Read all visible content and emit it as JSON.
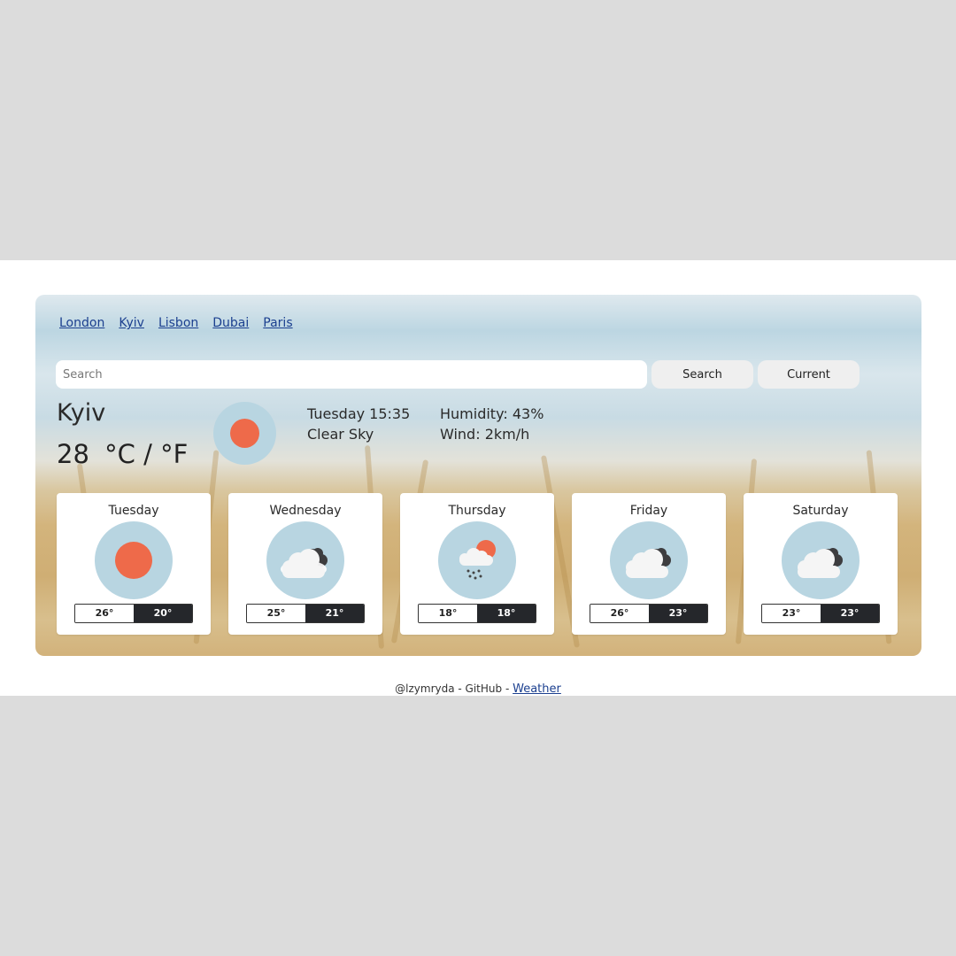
{
  "nav": {
    "cities": [
      "London",
      "Kyiv",
      "Lisbon",
      "Dubai",
      "Paris"
    ]
  },
  "search": {
    "placeholder": "Search",
    "search_label": "Search",
    "current_label": "Current"
  },
  "current": {
    "city": "Kyiv",
    "temperature": "28",
    "units": "°C / °F",
    "icon": "sun-icon",
    "datetime": "Tuesday 15:35",
    "description": "Clear Sky",
    "humidity": "Humidity: 43%",
    "wind": "Wind: 2km/h"
  },
  "forecast": [
    {
      "day": "Tuesday",
      "icon": "sun-icon",
      "max": "26°",
      "min": "20°"
    },
    {
      "day": "Wednesday",
      "icon": "cloud-icon",
      "max": "25°",
      "min": "21°"
    },
    {
      "day": "Thursday",
      "icon": "rain-sun-icon",
      "max": "18°",
      "min": "18°"
    },
    {
      "day": "Friday",
      "icon": "cloud-icon",
      "max": "26°",
      "min": "23°"
    },
    {
      "day": "Saturday",
      "icon": "cloud-icon",
      "max": "23°",
      "min": "23°"
    }
  ],
  "footer": {
    "author": "@lzymryda",
    "separator": " - ",
    "github": "GitHub",
    "repo_link": "Weather"
  },
  "colors": {
    "sun": "#ee6a4a",
    "icon_bg": "#b8d5e1",
    "link": "#1b3f8f",
    "temp_low_bg": "#25272b"
  }
}
